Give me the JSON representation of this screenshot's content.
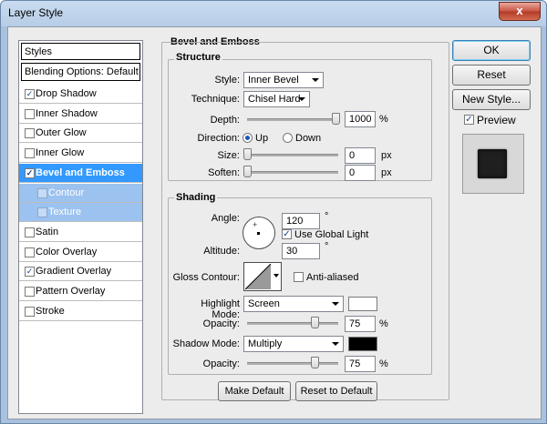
{
  "window": {
    "title": "Layer Style",
    "close_glyph": "x"
  },
  "styles_panel": {
    "header": "Styles",
    "blending_options": "Blending Options: Default",
    "items": [
      {
        "label": "Drop Shadow",
        "checked": true
      },
      {
        "label": "Inner Shadow",
        "checked": false
      },
      {
        "label": "Outer Glow",
        "checked": false
      },
      {
        "label": "Inner Glow",
        "checked": false
      },
      {
        "label": "Bevel and Emboss",
        "checked": true,
        "selected": true
      },
      {
        "label": "Contour",
        "checked": false,
        "sub": true
      },
      {
        "label": "Texture",
        "checked": false,
        "sub": true
      },
      {
        "label": "Satin",
        "checked": false
      },
      {
        "label": "Color Overlay",
        "checked": false
      },
      {
        "label": "Gradient Overlay",
        "checked": true
      },
      {
        "label": "Pattern Overlay",
        "checked": false
      },
      {
        "label": "Stroke",
        "checked": false
      }
    ]
  },
  "bevel": {
    "title": "Bevel and Emboss",
    "structure": {
      "title": "Structure",
      "style_label": "Style:",
      "style_value": "Inner Bevel",
      "technique_label": "Technique:",
      "technique_value": "Chisel Hard",
      "depth_label": "Depth:",
      "depth_value": "1000",
      "depth_unit": "%",
      "depth_level": 1.0,
      "direction_label": "Direction:",
      "direction_up": "Up",
      "direction_down": "Down",
      "direction_selected": "Up",
      "size_label": "Size:",
      "size_value": "0",
      "size_unit": "px",
      "size_level": 0.0,
      "soften_label": "Soften:",
      "soften_value": "0",
      "soften_unit": "px",
      "soften_level": 0.0
    },
    "shading": {
      "title": "Shading",
      "angle_label": "Angle:",
      "angle_value": "120",
      "angle_unit": "°",
      "use_global_light": "Use Global Light",
      "use_global_light_checked": true,
      "altitude_label": "Altitude:",
      "altitude_value": "30",
      "altitude_unit": "°",
      "gloss_contour_label": "Gloss Contour:",
      "anti_aliased": "Anti-aliased",
      "anti_aliased_checked": false,
      "highlight_mode_label": "Highlight Mode:",
      "highlight_mode_value": "Screen",
      "highlight_color": "#ffffff",
      "highlight_opacity_label": "Opacity:",
      "highlight_opacity_value": "75",
      "highlight_opacity_unit": "%",
      "highlight_opacity_level": 0.75,
      "shadow_mode_label": "Shadow Mode:",
      "shadow_mode_value": "Multiply",
      "shadow_color": "#000000",
      "shadow_opacity_label": "Opacity:",
      "shadow_opacity_value": "75",
      "shadow_opacity_unit": "%",
      "shadow_opacity_level": 0.75
    },
    "make_default": "Make Default",
    "reset_to_default": "Reset to Default"
  },
  "buttons": {
    "ok": "OK",
    "reset": "Reset",
    "new_style": "New Style...",
    "preview": "Preview",
    "preview_checked": true
  }
}
